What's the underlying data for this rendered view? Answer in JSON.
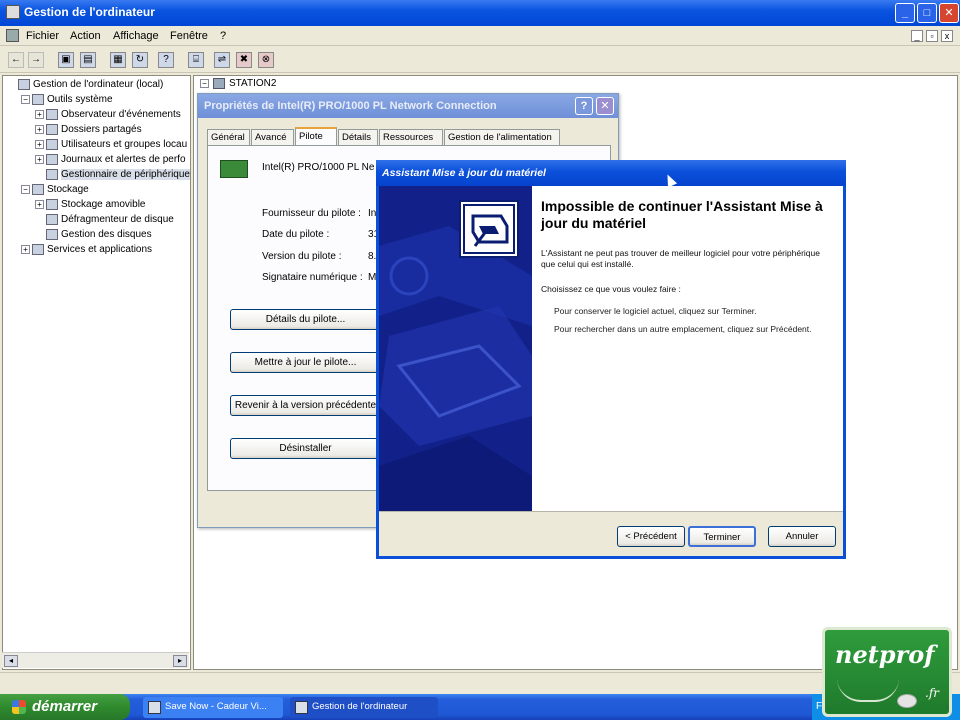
{
  "main_window": {
    "title": "Gestion de l'ordinateur"
  },
  "menu": {
    "items": [
      "Fichier",
      "Action",
      "Affichage",
      "Fenêtre",
      "?"
    ]
  },
  "tree": {
    "items": [
      {
        "label": "Gestion de l'ordinateur (local)",
        "level": 0,
        "expander": ""
      },
      {
        "label": "Outils système",
        "level": 1,
        "expander": "−"
      },
      {
        "label": "Observateur d'événements",
        "level": 2,
        "expander": "+"
      },
      {
        "label": "Dossiers partagés",
        "level": 2,
        "expander": "+"
      },
      {
        "label": "Utilisateurs et groupes locau",
        "level": 2,
        "expander": "+"
      },
      {
        "label": "Journaux et alertes de perfo",
        "level": 2,
        "expander": "+"
      },
      {
        "label": "Gestionnaire de périphérique",
        "level": 2,
        "expander": "",
        "selected": true
      },
      {
        "label": "Stockage",
        "level": 1,
        "expander": "−"
      },
      {
        "label": "Stockage amovible",
        "level": 2,
        "expander": "+"
      },
      {
        "label": "Défragmenteur de disque",
        "level": 2,
        "expander": ""
      },
      {
        "label": "Gestion des disques",
        "level": 2,
        "expander": ""
      },
      {
        "label": "Services et applications",
        "level": 1,
        "expander": "+"
      }
    ]
  },
  "right_pane": {
    "computer_name": "STATION2"
  },
  "properties_dialog": {
    "title": "Propriétés de Intel(R) PRO/1000 PL Network Connection",
    "tabs": [
      "Général",
      "Avancé",
      "Pilote",
      "Détails",
      "Ressources",
      "Gestion de l'alimentation"
    ],
    "active_tab": "Pilote",
    "device_name": "Intel(R) PRO/1000 PL Ne",
    "fields": [
      {
        "label": "Fournisseur du pilote :",
        "value": "Int"
      },
      {
        "label": "Date du pilote :",
        "value": "31"
      },
      {
        "label": "Version du pilote :",
        "value": "8."
      },
      {
        "label": "Signataire numérique :",
        "value": "Mi"
      }
    ],
    "buttons": {
      "details": "Détails du pilote...",
      "update": "Mettre à jour le pilote...",
      "rollback": "Revenir à la version précédente",
      "uninstall": "Désinstaller"
    }
  },
  "wizard": {
    "title": "Assistant Mise à jour du matériel",
    "heading": "Impossible de continuer l'Assistant Mise à jour du matériel",
    "para1": "L'Assistant ne peut pas trouver de meilleur logiciel pour votre périphérique que celui qui est installé.",
    "para2": "Choisissez ce que vous voulez faire :",
    "bullet1": "Pour conserver le logiciel actuel, cliquez sur Terminer.",
    "bullet2": "Pour rechercher dans un autre emplacement, cliquez sur Précédent.",
    "buttons": {
      "back": "< Précédent",
      "finish": "Terminer",
      "cancel": "Annuler"
    }
  },
  "taskbar": {
    "start_label": "démarrer",
    "tasks": [
      "Save Now - Cadeur Vi...",
      "Gestion de l'ordinateur"
    ],
    "tray_text": "FR"
  },
  "logo": {
    "word": "netprof",
    "suffix": ".fr"
  },
  "colors": {
    "xp_blue": "#0a54e0",
    "inactive_title": "#7f9ad8",
    "wizard_side": "#12218a",
    "start_green": "#2f8a2d",
    "logo_green": "#2f9c3c"
  }
}
